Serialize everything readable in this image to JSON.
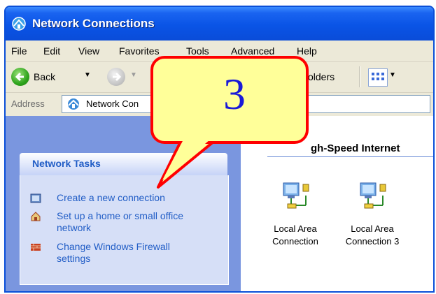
{
  "window": {
    "title": "Network Connections",
    "icon": "network-connections-icon"
  },
  "menu": [
    "File",
    "Edit",
    "View",
    "Favorites",
    "Tools",
    "Advanced",
    "Help"
  ],
  "toolbar": {
    "back_label": "Back",
    "folders_label": "olders",
    "back_icon": "back-arrow-icon",
    "forward_icon": "forward-arrow-icon",
    "views_icon": "views-icon"
  },
  "address": {
    "label": "Address",
    "value": "Network Con"
  },
  "tasks": {
    "header": "Network Tasks",
    "items": [
      {
        "label": "Create a new connection",
        "icon": "new-connection-icon"
      },
      {
        "label": "Set up a home or small office network",
        "icon": "home-network-icon"
      },
      {
        "label": "Change Windows Firewall settings",
        "icon": "firewall-icon"
      }
    ]
  },
  "group": {
    "header": "gh-Speed Internet",
    "items": [
      {
        "label": "Local Area Connection",
        "icon": "lan-connection-icon"
      },
      {
        "label": "Local Area Connection 3",
        "icon": "lan-connection-icon"
      }
    ]
  },
  "callout": {
    "number": "3",
    "fill": "#ffff99",
    "border": "#ff0000",
    "text_color": "#1a1ad8"
  },
  "colors": {
    "title_blue": "#0a54e6",
    "task_link": "#215dc6",
    "left_pane": "#7a96df"
  }
}
